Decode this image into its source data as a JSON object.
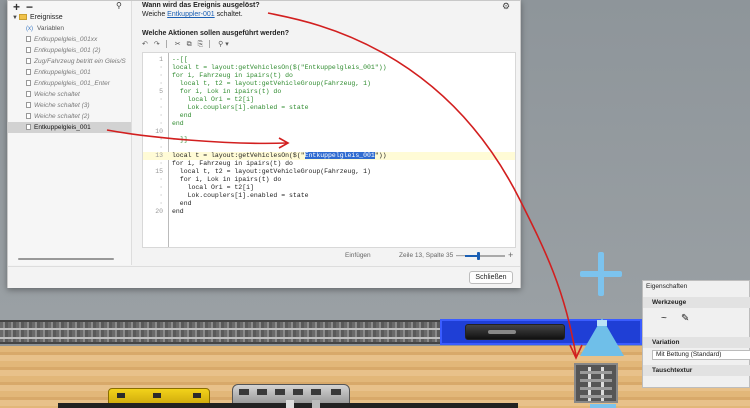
{
  "tree": {
    "root_label": "Ereignisse",
    "items": [
      {
        "label": "Variablen",
        "style": "vars"
      },
      {
        "label": "Entkuppelgleis_001xx",
        "style": "italic"
      },
      {
        "label": "Entkuppelgleis_001 (2)",
        "style": "italic"
      },
      {
        "label": "Zug/Fahrzeug betritt ein Gleis/S",
        "style": "italic"
      },
      {
        "label": "Entkuppelgleis_001",
        "style": "italic"
      },
      {
        "label": "Entkuppelgleis_001_Enter",
        "style": "italic"
      },
      {
        "label": "Weiche schaltet",
        "style": "italic"
      },
      {
        "label": "Weiche schaltet (3)",
        "style": "italic"
      },
      {
        "label": "Weiche schaltet (2)",
        "style": "italic"
      },
      {
        "label": "Entkuppelgleis_001",
        "style": "selected"
      }
    ]
  },
  "trigger": {
    "heading": "Wann wird das Ereignis ausgelöst?",
    "prefix": "Weiche ",
    "link": "Entkuppler-001",
    "suffix": " schaltet."
  },
  "actions_heading": "Welche Aktionen sollen ausgeführt werden?",
  "toolbar": {
    "undo": "↶",
    "redo": "↷",
    "cut": "✂",
    "copy": "⧉",
    "paste": "⎘",
    "search": "⚲ ▾"
  },
  "code": [
    {
      "ln": "1",
      "text": "--[[",
      "comment": true
    },
    {
      "ln": "·",
      "text": "local t = layout:getVehiclesOn($(\"Entkuppelgleis_001\"))",
      "comment": true
    },
    {
      "ln": "·",
      "text": "for i, Fahrzeug in ipairs(t) do",
      "comment": true
    },
    {
      "ln": "·",
      "text": "  local t, t2 = layout:getVehicleGroup(Fahrzeug, 1)",
      "comment": true
    },
    {
      "ln": "5",
      "text": "  for i, Lok in ipairs(t) do",
      "comment": true
    },
    {
      "ln": "·",
      "text": "    local Ori = t2[i]",
      "comment": true
    },
    {
      "ln": "·",
      "text": "    Lok.couplers[1].enabled = state",
      "comment": true
    },
    {
      "ln": "·",
      "text": "  end",
      "comment": true
    },
    {
      "ln": "·",
      "text": "end",
      "comment": true
    },
    {
      "ln": "10",
      "text": "",
      "comment": false
    },
    {
      "ln": "·",
      "text": "--]]",
      "comment": true
    },
    {
      "ln": "·",
      "text": "",
      "comment": false
    },
    {
      "ln": "13",
      "text_pre": "local t = layout:getVehiclesOn($(\"",
      "text_sel": "Entkuppelgleis_001",
      "text_post": "\"))",
      "highlight": true
    },
    {
      "ln": "·",
      "text": "for i, Fahrzeug in ipairs(t) do",
      "comment": false
    },
    {
      "ln": "15",
      "text": "  local t, t2 = layout:getVehicleGroup(Fahrzeug, 1)",
      "comment": false
    },
    {
      "ln": "·",
      "text": "  for i, Lok in ipairs(t) do",
      "comment": false
    },
    {
      "ln": "·",
      "text": "    local Ori = t2[i]",
      "comment": false
    },
    {
      "ln": "·",
      "text": "    Lok.couplers[1].enabled = state",
      "comment": false
    },
    {
      "ln": "·",
      "text": "  end",
      "comment": false
    },
    {
      "ln": "20",
      "text": "end",
      "comment": false
    }
  ],
  "status": {
    "insert_mode": "Einfügen",
    "position": "Zeile 13, Spalte 35",
    "zoom_minus": "—",
    "zoom_plus": "+",
    "zoom_fraction": 0.33
  },
  "close_label": "Schließen",
  "properties": {
    "title": "Eigenschaften",
    "tools_heading": "Werkzeuge",
    "variation_heading": "Variation",
    "variation_value": "Mit Bettung (Standard)",
    "texture_heading": "Tauschtextur"
  },
  "colors": {
    "annotation_arrow": "#d21f1f",
    "link": "#1a5fb4",
    "selection": "#2f6bd1",
    "comment": "#2e8b2e",
    "highlight_track": "#1f3fd6"
  }
}
